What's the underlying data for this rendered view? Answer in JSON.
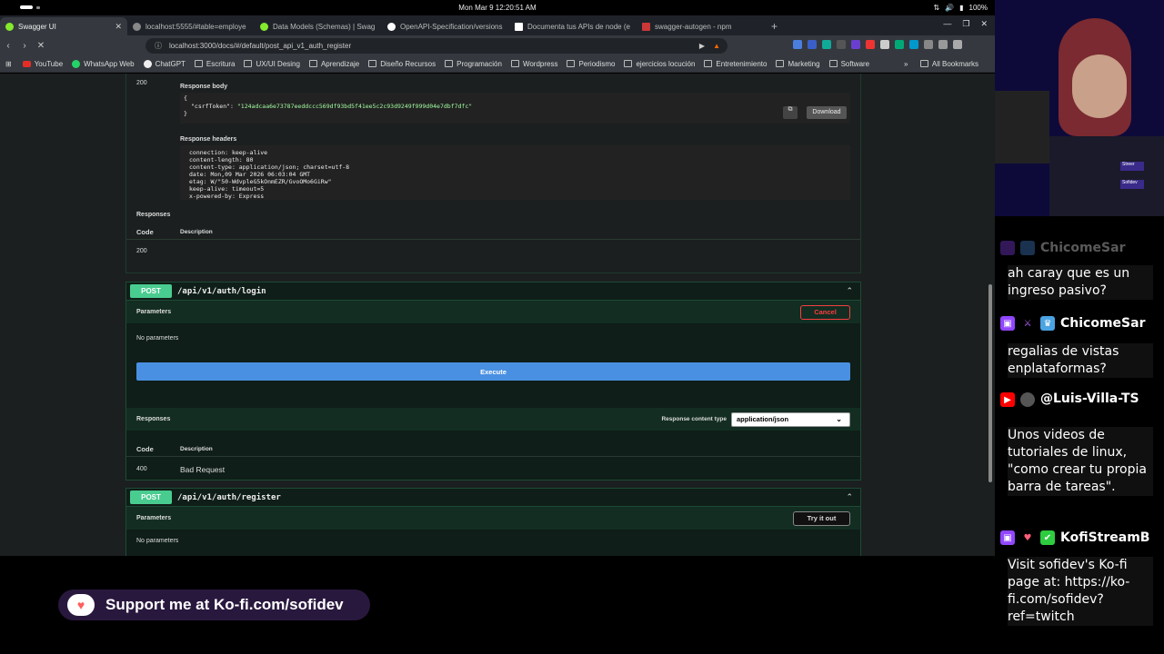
{
  "system": {
    "clock": "Mon Mar 9  12:20:51 AM",
    "battery": "100%"
  },
  "tabs": [
    {
      "label": "Swagger UI",
      "color": "#85ea2d",
      "active": true
    },
    {
      "label": "localhost:5555/#table=employe",
      "color": "#888888"
    },
    {
      "label": "Data Models (Schemas) | Swag",
      "color": "#85ea2d"
    },
    {
      "label": "OpenAPI-Specification/versions",
      "color": "#ffffff"
    },
    {
      "label": "Documenta tus APIs de node (e",
      "color": "#ffffff"
    },
    {
      "label": "swagger-autogen - npm",
      "color": "#cb3837"
    }
  ],
  "address": "localhost:3000/docs/#/default/post_api_v1_auth_register",
  "bookmarks": [
    "YouTube",
    "WhatsApp Web",
    "ChatGPT",
    "Escritura",
    "UX/UI Desing",
    "Aprendizaje",
    "Diseño Recursos",
    "Programación",
    "Wordpress",
    "Periodismo",
    "ejercicios locución",
    "Entretenimiento",
    "Marketing",
    "Software"
  ],
  "all_bookmarks": "All Bookmarks",
  "response_panel": {
    "code": "200",
    "body_label": "Response body",
    "body_lines": [
      "{",
      "  \"csrfToken\": ",
      "}"
    ],
    "csrf_key": "\"csrfToken\":",
    "csrf_value": "\"124adcaa6e73787eeddccc569df93bd5f41ee5c2c93d9249f999d04e7dbf7dfc\"",
    "download_label": "Download",
    "headers_label": "Response headers",
    "headers": [
      "connection: keep-alive",
      "content-length: 80",
      "content-type: application/json; charset=utf-8",
      "date: Mon,09 Mar 2026 06:03:04 GMT",
      "etag: W/\"50-WdvpleG5kOnmEZR/GvoOMo6GiRw\"",
      "keep-alive: timeout=5",
      "x-powered-by: Express"
    ],
    "responses_label": "Responses",
    "col_code": "Code",
    "col_desc": "Description",
    "row_code": "200"
  },
  "login": {
    "method": "POST",
    "path": "/api/v1/auth/login",
    "params_label": "Parameters",
    "cancel_label": "Cancel",
    "no_params": "No parameters",
    "execute_label": "Execute",
    "responses_label": "Responses",
    "content_type_label": "Response content type",
    "content_type_value": "application/json",
    "col_code": "Code",
    "col_desc": "Description",
    "row_code": "400",
    "row_desc": "Bad Request"
  },
  "register": {
    "method": "POST",
    "path": "/api/v1/auth/register",
    "params_label": "Parameters",
    "try_label": "Try it out",
    "no_params": "No parameters"
  },
  "kofi_banner": "Support me at Ko-fi.com/sofidev",
  "chat": {
    "partial_user": "ChicomeSar",
    "msg1": "ah caray que es un ingreso pasivo?",
    "user2": "ChicomeSar",
    "msg2": "regalias de vistas enplataformas?",
    "user3": "@Luis-Villa-TS",
    "msg3": "Unos videos de tutoriales de linux, \"como crear tu propia barra de tareas\".",
    "user4": "KofiStreamB",
    "msg4": "Visit sofidev's Ko-fi page at: https://ko-fi.com/sofidev?ref=twitch"
  },
  "cam_labels": [
    "Streer",
    "Sofidev"
  ]
}
